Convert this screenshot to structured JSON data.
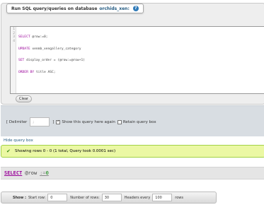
{
  "sql_box": {
    "legend_prefix": "Run SQL query/queries on database",
    "database": "orchids_xen:",
    "help_icon": "?",
    "line_numbers": "1\n2\n3\n4",
    "code_lines": [
      {
        "kw": "SELECT",
        "rest": " @row:=0;"
      },
      {
        "kw": "UPDATE",
        "rest": " xenmb_xengallery_category"
      },
      {
        "kw": "SET",
        "rest": " display_order = (@row:=@row+1)"
      },
      {
        "kw": "ORDER BY",
        "rest": " title ASC;"
      }
    ],
    "clear_label": "Clear"
  },
  "options": {
    "delimiter_open": "[ Delimiter",
    "delimiter_value": ";",
    "delimiter_close": "]",
    "show_again_label": "Show this query here again",
    "show_again_checked": "✓",
    "retain_label": "Retain query box"
  },
  "hide_link": "Hide query box",
  "result": {
    "message": "Showing rows 0 - 0 (1 total, Query took 0.0001 sec)"
  },
  "sql_display": {
    "keyword": "SELECT",
    "variable": "@row",
    "operator": ":=",
    "value": "0"
  },
  "nav": {
    "show_label": "Show :",
    "start_row_label": "Start row:",
    "start_row_value": "0",
    "num_rows_label": "Number of rows:",
    "num_rows_value": "30",
    "headers_every_label": "Headers every",
    "headers_every_value": "100",
    "rows_suffix": "rows"
  },
  "colors": {
    "keyword": "#990099",
    "link": "#235a81",
    "success_bg": "#ebf8a4"
  }
}
